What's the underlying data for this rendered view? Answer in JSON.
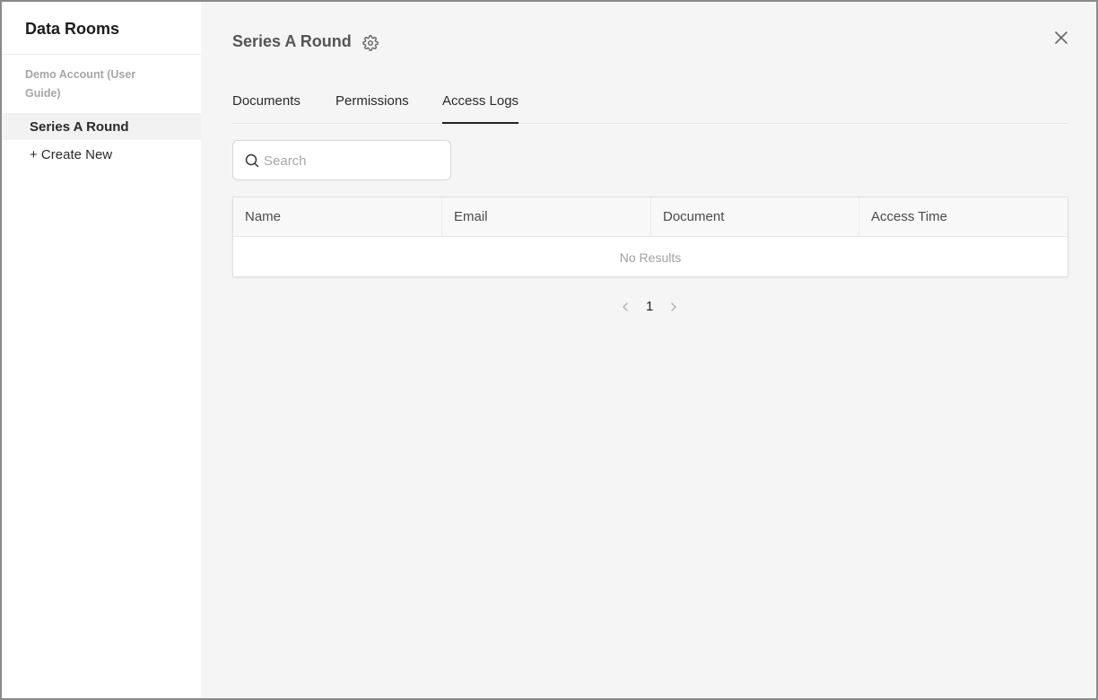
{
  "sidebar": {
    "title": "Data Rooms",
    "account_label": "Demo Account (User Guide)",
    "items": [
      {
        "label": "Series A Round",
        "selected": true
      }
    ],
    "create_label": "+ Create New"
  },
  "header": {
    "title": "Series A Round",
    "settings_icon": "gear-icon",
    "close_icon": "close-icon"
  },
  "tabs": [
    {
      "label": "Documents",
      "active": false
    },
    {
      "label": "Permissions",
      "active": false
    },
    {
      "label": "Access Logs",
      "active": true
    }
  ],
  "search": {
    "placeholder": "Search",
    "value": "",
    "icon": "search-icon"
  },
  "table": {
    "columns": [
      "Name",
      "Email",
      "Document",
      "Access Time"
    ],
    "rows": [],
    "empty_text": "No Results"
  },
  "pagination": {
    "current_page": "1"
  }
}
